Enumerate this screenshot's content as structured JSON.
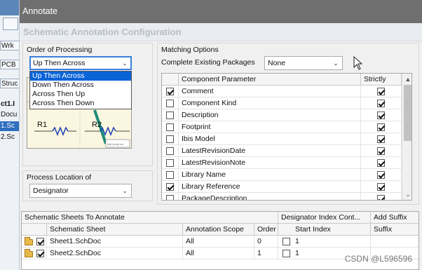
{
  "background": {
    "items": [
      "Wrk",
      "PCB",
      "Struc",
      "ct1.I",
      "Docu",
      "1.Sc",
      "2.Sc"
    ]
  },
  "dialog": {
    "title": "Annotate",
    "header": "Schematic Annotation Configuration"
  },
  "order": {
    "label": "Order of Processing",
    "selected": "Up Then Across",
    "options": [
      "Up Then Across",
      "Down Then Across",
      "Across Then Up",
      "Across Then Down"
    ],
    "preview_labels": [
      "R1",
      "R2",
      "MyCircuit.cm"
    ]
  },
  "process_location": {
    "label": "Process Location of",
    "selected": "Designator"
  },
  "matching": {
    "label": "Matching Options",
    "complete_label": "Complete Existing Packages",
    "complete_value": "None",
    "columns": [
      "Component Parameter",
      "Strictly"
    ],
    "rows": [
      {
        "name": "Comment",
        "checked": true,
        "strictly": true
      },
      {
        "name": "Component Kind",
        "checked": false,
        "strictly": true
      },
      {
        "name": "Description",
        "checked": false,
        "strictly": true
      },
      {
        "name": "Footprint",
        "checked": false,
        "strictly": true
      },
      {
        "name": "Ibis Model",
        "checked": false,
        "strictly": true
      },
      {
        "name": "LatestRevisionDate",
        "checked": false,
        "strictly": true
      },
      {
        "name": "LatestRevisionNote",
        "checked": false,
        "strictly": true
      },
      {
        "name": "Library Name",
        "checked": false,
        "strictly": true
      },
      {
        "name": "Library Reference",
        "checked": true,
        "strictly": true
      },
      {
        "name": "PackageDescription",
        "checked": false,
        "strictly": true
      }
    ]
  },
  "sheets": {
    "group_headers": [
      "Schematic Sheets To Annotate",
      "Designator Index Cont...",
      "Add Suffix"
    ],
    "columns": [
      "Schematic Sheet",
      "Annotation Scope",
      "Order",
      "Start Index",
      "Suffix"
    ],
    "rows": [
      {
        "sheet": "Sheet1.SchDoc",
        "scope": "All",
        "order": "0",
        "start": "1",
        "checked": true
      },
      {
        "sheet": "Sheet2.SchDoc",
        "scope": "All",
        "order": "1",
        "start": "1",
        "checked": true
      }
    ]
  },
  "watermark": "CSDN @L596596",
  "colors": {
    "titlebar": "#6f6f6f",
    "selection": "#0a64d7",
    "header_text": "#b7bdc5"
  }
}
